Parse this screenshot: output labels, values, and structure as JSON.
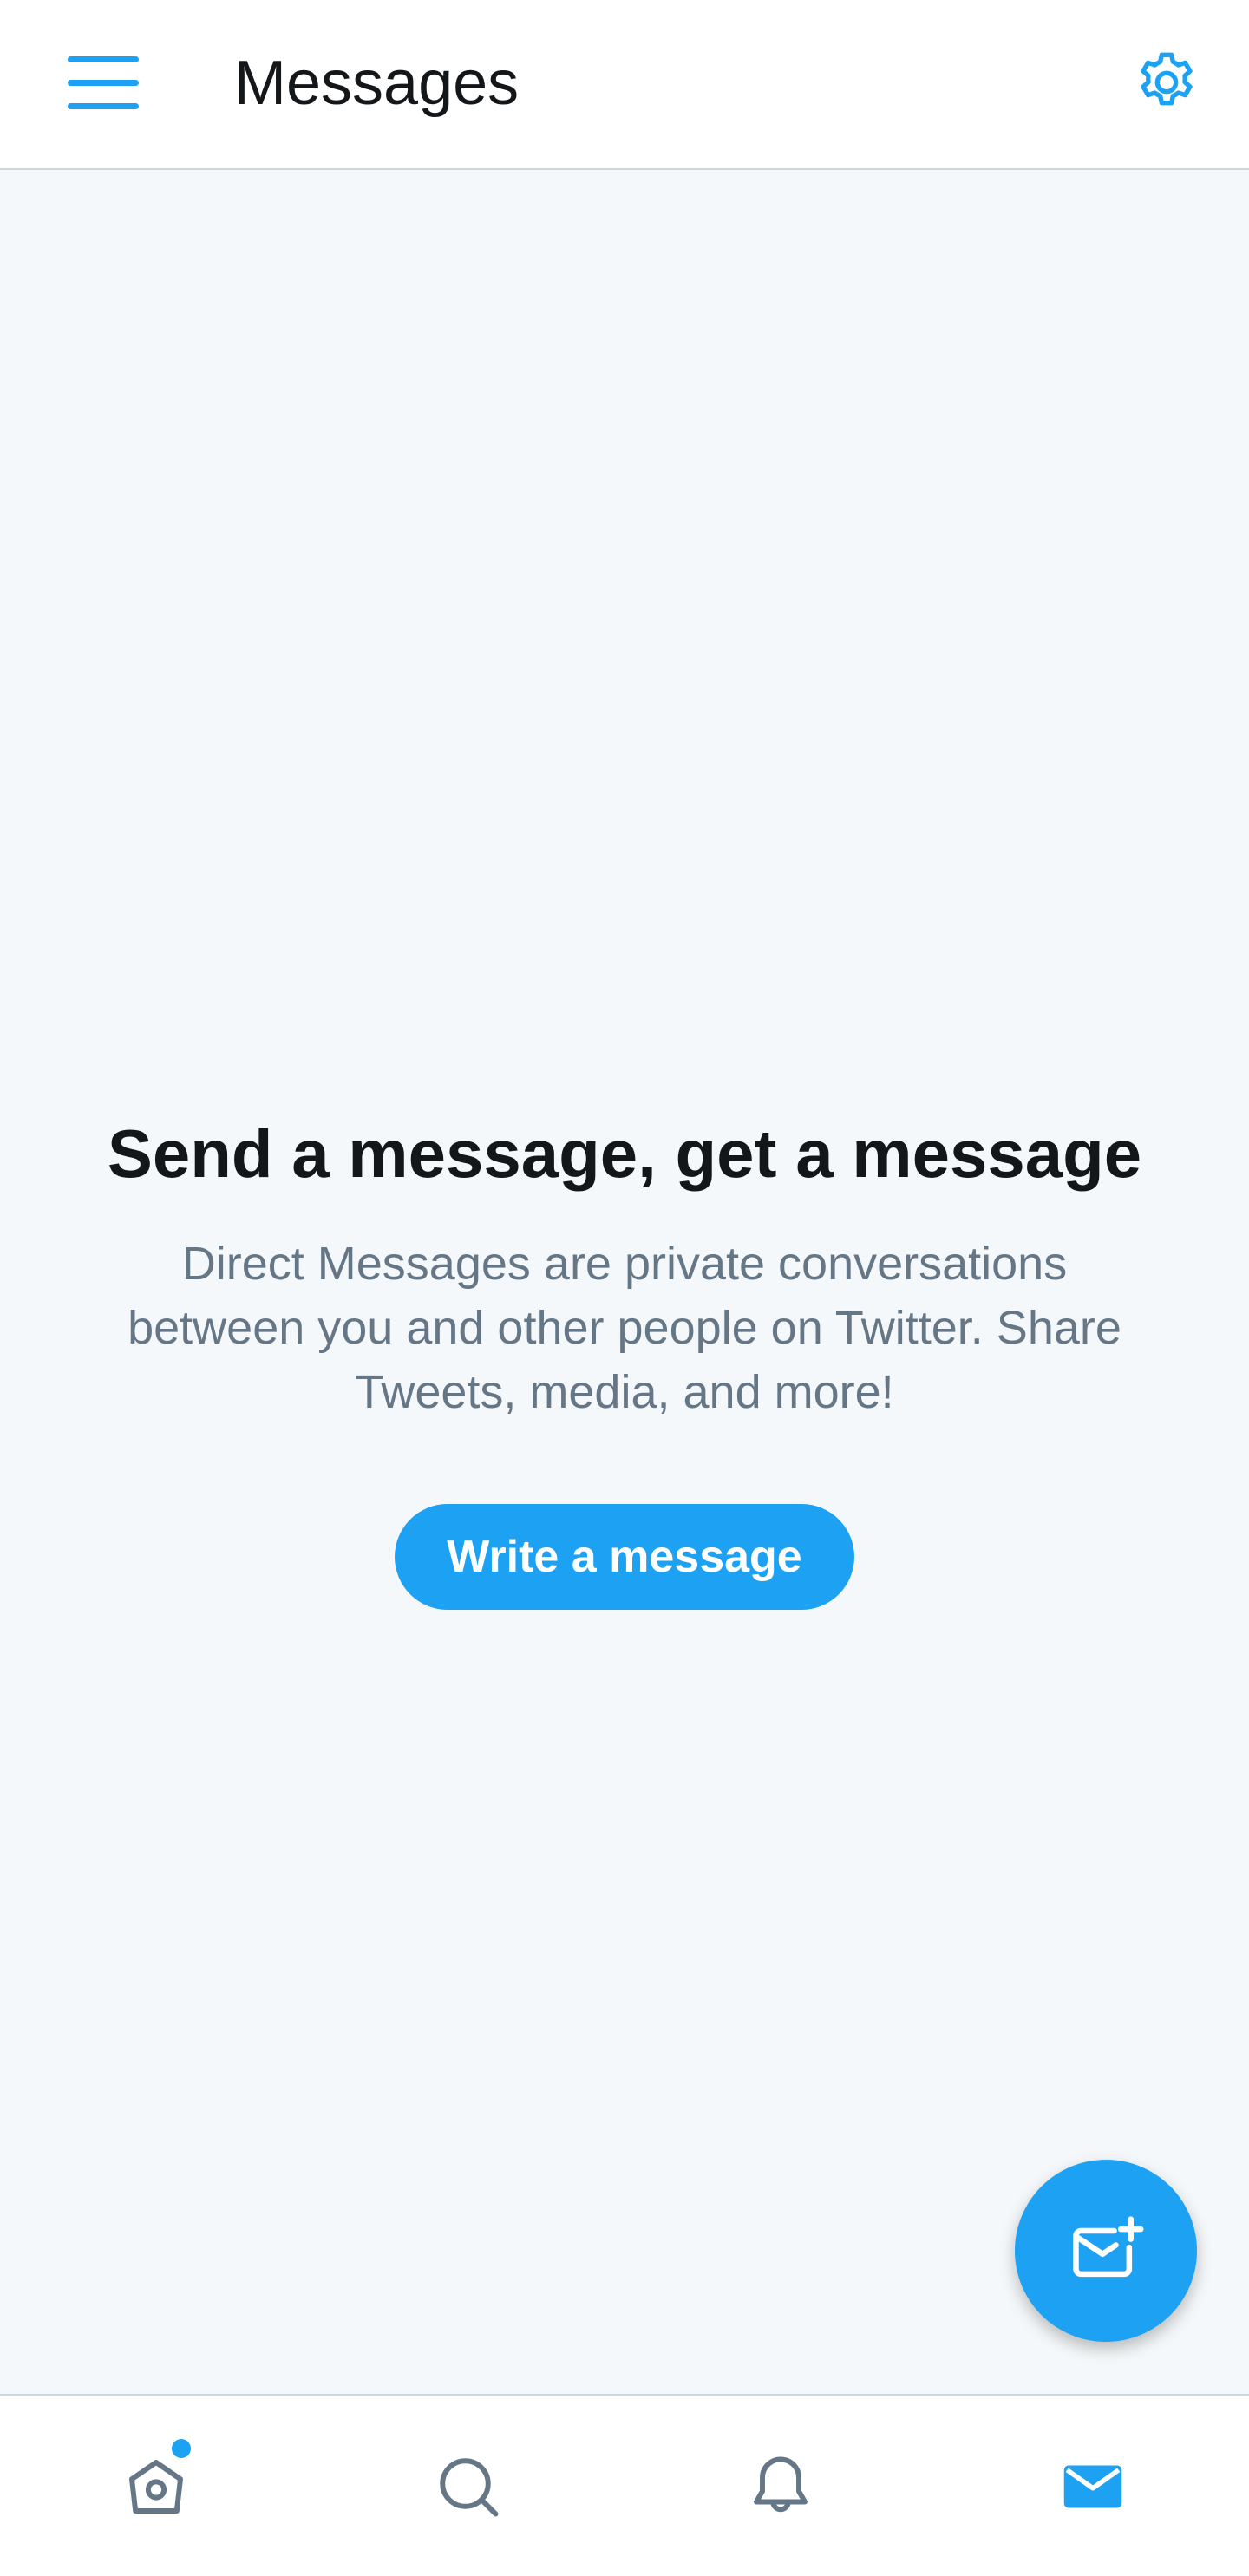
{
  "header": {
    "title": "Messages",
    "menu_icon": "hamburger-menu-icon",
    "settings_icon": "gear-icon"
  },
  "empty_state": {
    "title": "Send a message, get a message",
    "description": "Direct Messages are private conversations between you and other people on Twitter. Share Tweets, media, and more!",
    "button_label": "Write a message"
  },
  "fab": {
    "icon": "new-message-icon"
  },
  "bottom_nav": {
    "items": [
      {
        "name": "home",
        "icon": "home-icon",
        "has_badge": true
      },
      {
        "name": "search",
        "icon": "search-icon"
      },
      {
        "name": "notifications",
        "icon": "bell-icon"
      },
      {
        "name": "messages",
        "icon": "envelope-icon",
        "active": true
      }
    ]
  },
  "colors": {
    "accent": "#1da1f2",
    "text_primary": "#14171a",
    "text_secondary": "#657786",
    "background": "#f5f8fa",
    "nav_icon": "#657786"
  }
}
